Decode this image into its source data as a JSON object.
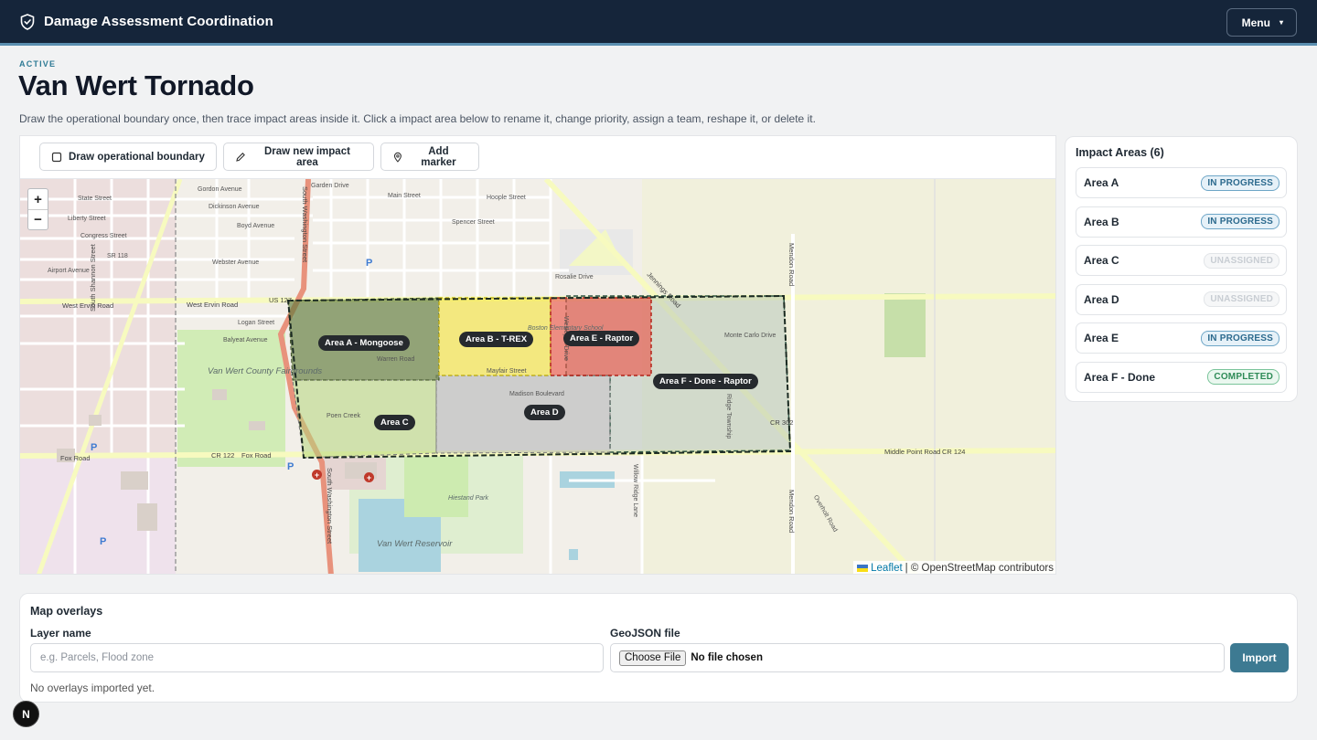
{
  "header": {
    "app_title": "Damage Assessment Coordination",
    "logo_icon": "shield-icon",
    "menu_label": "Menu"
  },
  "incident": {
    "status": "ACTIVE",
    "title": "Van Wert Tornado",
    "description": "Draw the operational boundary once, then trace impact areas inside it. Click a impact area below to rename it, change priority, assign a team, reshape it, or delete it."
  },
  "toolbar": {
    "draw_boundary": "Draw operational boundary",
    "draw_area": "Draw new impact area",
    "add_marker": "Add marker"
  },
  "map": {
    "zoom_in": "+",
    "zoom_out": "−",
    "attribution_leaflet": "Leaflet",
    "attribution_rest": "| © OpenStreetMap contributors",
    "area_labels": {
      "a": "Area A - Mongoose",
      "b": "Area B - T-REX",
      "e": "Area E - Raptor",
      "f": "Area F - Done - Raptor",
      "c": "Area C",
      "d": "Area D"
    },
    "streets": {
      "gordon": "Gordon Avenue",
      "garden": "Garden Drive",
      "dickinson": "Dickinson Avenue",
      "boyd": "Boyd Avenue",
      "liberty": "Liberty Street",
      "congress": "Congress Street",
      "sr118": "SR 118",
      "airport": "Airport Avenue",
      "webster": "Webster Avenue",
      "west_ervin_1": "West Ervin Road",
      "west_ervin_2": "West Ervin Road",
      "us127": "US 127",
      "logan": "Logan Street",
      "balyeat": "Balyeat Avenue",
      "fox_1": "Fox Road",
      "fox_2": "Fox Road",
      "cr122": "CR 122",
      "middle_point": "Middle Point Road",
      "cr124": "CR 124",
      "cr302": "CR 302",
      "rosalie": "Rosalie Drive",
      "spencer": "Spencer Street",
      "hoople": "Hoople Street",
      "state": "State Street",
      "main": "Main Street",
      "mayfair": "Mayfair Street",
      "warren": "Warren Road",
      "poen": "Poen Creek",
      "madison": "Madison Boulevard",
      "monte_carlo": "Monte Carlo Drive",
      "fairgrounds": "Van Wert County Fairgrounds",
      "reservoir": "Van Wert Reservoir",
      "hiestand": "Hiestand Park",
      "school": "Boston Elementary School",
      "s_washington": "South Washington Street",
      "s_washington_2": "South Washington Street",
      "s_shannon": "South Shannon Street",
      "jennings": "Jennings Road",
      "mendon": "Mendon Road",
      "mendon_2": "Mendon Road",
      "ridge": "Ridge Township",
      "willow_ridge": "Willow Ridge Lane",
      "dhabi": "Overholt Road",
      "wesleyan": "Wesleyan Drive"
    }
  },
  "impact_areas": {
    "title": "Impact Areas (6)",
    "items": [
      {
        "name": "Area A",
        "status": "IN PROGRESS"
      },
      {
        "name": "Area B",
        "status": "IN PROGRESS"
      },
      {
        "name": "Area C",
        "status": "UNASSIGNED"
      },
      {
        "name": "Area D",
        "status": "UNASSIGNED"
      },
      {
        "name": "Area E",
        "status": "IN PROGRESS"
      },
      {
        "name": "Area F - Done",
        "status": "COMPLETED"
      }
    ]
  },
  "overlays": {
    "title": "Map overlays",
    "layer_label": "Layer name",
    "layer_placeholder": "e.g. Parcels, Flood zone",
    "geojson_label": "GeoJSON file",
    "choose_file": "Choose File",
    "file_status": "No file chosen",
    "import_label": "Import",
    "empty_message": "No overlays imported yet."
  },
  "dev_badge": "N",
  "colors": {
    "header_bg": "#15253a",
    "accent": "#3d7a92",
    "in_progress": "#2c6a8e",
    "completed": "#2e8b57",
    "area_a": "#6e8a4a",
    "area_b": "#f2e66a",
    "area_e": "#e86a5e",
    "area_f": "#c9d3cc",
    "area_c": "#c9dfa0",
    "area_d": "#c7c9cc"
  }
}
